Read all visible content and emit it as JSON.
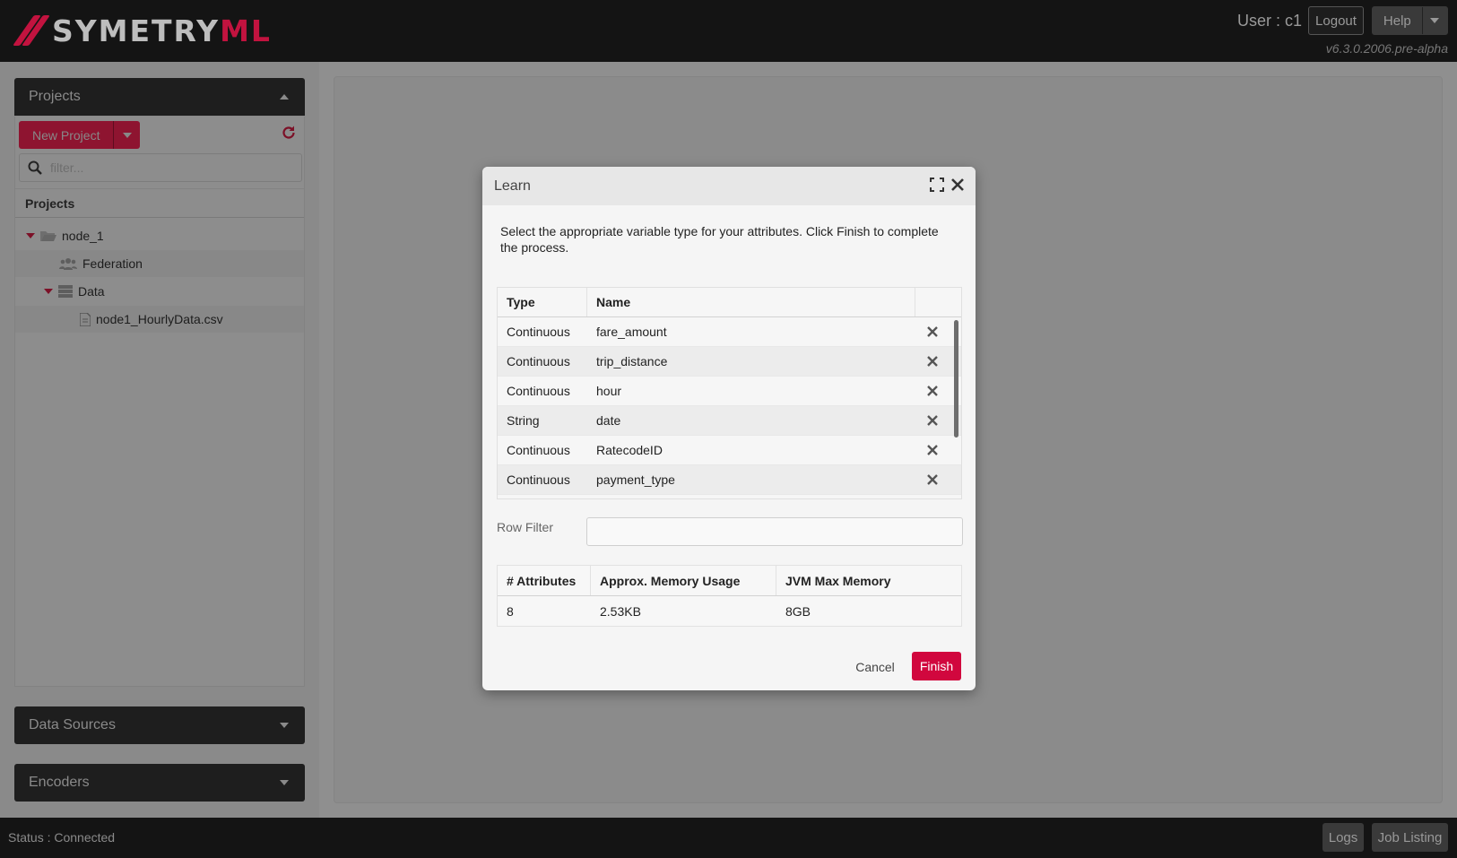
{
  "header": {
    "logo_main": "SYMETRY",
    "logo_accent": "ML",
    "user_label": "User : c1",
    "logout_label": "Logout",
    "help_label": "Help",
    "version": "v6.3.0.2006.pre-alpha"
  },
  "sidebar": {
    "projects_title": "Projects",
    "new_project_label": "New Project",
    "filter_placeholder": "filter...",
    "tree_header": "Projects",
    "tree": [
      {
        "label": "node_1",
        "icon": "folder-open-icon"
      },
      {
        "label": "Federation",
        "icon": "users-icon"
      },
      {
        "label": "Data",
        "icon": "database-icon"
      },
      {
        "label": "node1_HourlyData.csv",
        "icon": "file-icon"
      }
    ],
    "data_sources_title": "Data Sources",
    "encoders_title": "Encoders"
  },
  "footer": {
    "status": "Status : Connected",
    "logs_label": "Logs",
    "jobs_label": "Job Listing"
  },
  "dialog": {
    "title": "Learn",
    "description": "Select the appropriate variable type for your attributes. Click Finish to complete the process.",
    "columns": {
      "type": "Type",
      "name": "Name"
    },
    "rows": [
      {
        "type": "Continuous",
        "name": "fare_amount"
      },
      {
        "type": "Continuous",
        "name": "trip_distance"
      },
      {
        "type": "Continuous",
        "name": "hour"
      },
      {
        "type": "String",
        "name": "date"
      },
      {
        "type": "Continuous",
        "name": "RatecodeID"
      },
      {
        "type": "Continuous",
        "name": "payment_type"
      }
    ],
    "row_filter_label": "Row Filter",
    "row_filter_value": "",
    "stats_headers": {
      "attributes": "# Attributes",
      "memory": "Approx. Memory Usage",
      "jvm": "JVM Max Memory"
    },
    "stats_values": {
      "attributes": "8",
      "memory": "2.53KB",
      "jvm": "8GB"
    },
    "cancel_label": "Cancel",
    "finish_label": "Finish"
  },
  "colors": {
    "brand": "#c2133f",
    "finish": "#d1073e",
    "header_bg": "#141414"
  }
}
